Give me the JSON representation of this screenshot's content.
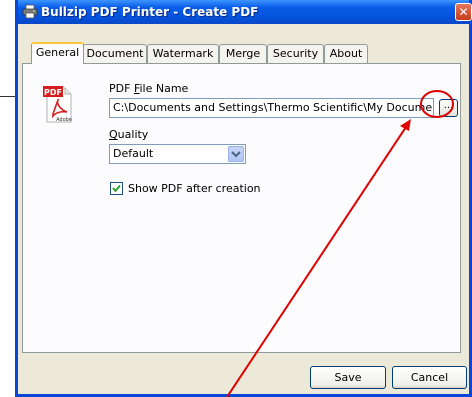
{
  "window": {
    "title": "Bullzip PDF Printer - Create PDF",
    "close_glyph": "✕",
    "title_icon": "printer-icon"
  },
  "tabs": [
    {
      "label": "General",
      "active": true
    },
    {
      "label": "Document",
      "active": false
    },
    {
      "label": "Watermark",
      "active": false
    },
    {
      "label": "Merge",
      "active": false
    },
    {
      "label": "Security",
      "active": false
    },
    {
      "label": "About",
      "active": false
    }
  ],
  "general": {
    "file_icon": "adobe-pdf-icon",
    "pdf_badge": "PDF",
    "adobe_text": "Adobe",
    "file_name_label_pre": "PDF ",
    "file_name_label_accel": "F",
    "file_name_label_post": "ile Name",
    "file_name_value": "C:\\Documents and Settings\\Thermo Scientific\\My Documents\\ab",
    "browse_label": "...",
    "quality_label_accel": "Q",
    "quality_label_post": "uality",
    "quality_value": "Default",
    "show_pdf_checked": true,
    "show_pdf_label": "Show PDF after creation"
  },
  "buttons": {
    "save": "Save",
    "cancel": "Cancel"
  },
  "annotations": {
    "highlight_color": "#e00000",
    "arrow_color": "#e00000"
  },
  "colors": {
    "titlebar": "#0453dd",
    "dialog_bg": "#ece9d8",
    "tab_highlight": "#ffc83c"
  }
}
